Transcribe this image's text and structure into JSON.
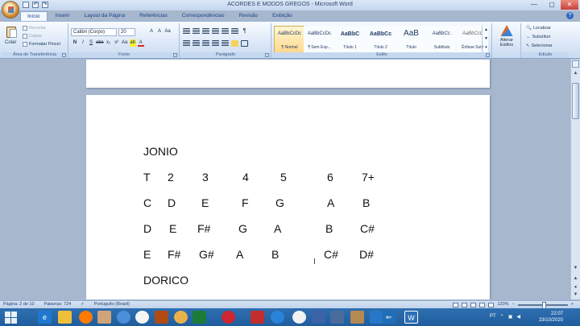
{
  "window": {
    "title": "ACORDES E MODOS GREGOS - Microsoft Word",
    "controls": [
      "—",
      "▢",
      "✕"
    ]
  },
  "ribbon": {
    "tabs": [
      "Início",
      "Inserir",
      "Layout da Página",
      "Referências",
      "Correspondências",
      "Revisão",
      "Exibição"
    ],
    "help": "?",
    "clipboard": {
      "paste": "Colar",
      "cut": "Recortar",
      "copy": "Copiar",
      "format_painter": "Formatar Pincel",
      "label": "Área de Transferência"
    },
    "font": {
      "name": "Calibri (Corpo)",
      "size": "20",
      "grow": "A",
      "shrink": "A",
      "clear": "Aa",
      "bold": "N",
      "italic": "I",
      "underline": "S",
      "strike": "abc",
      "subscript": "x₂",
      "superscript": "x²",
      "change_case": "Aa",
      "highlight": "ab",
      "font_color": "A",
      "label": "Fonte"
    },
    "paragraph": {
      "label": "Parágrafo",
      "pilcrow": "¶"
    },
    "styles": {
      "items": [
        {
          "sample": "AaBbCcDc",
          "name": "¶ Normal"
        },
        {
          "sample": "AaBbCcDc",
          "name": "¶ Sem Esp..."
        },
        {
          "sample": "AaBbC",
          "name": "Título 1"
        },
        {
          "sample": "AaBbCc",
          "name": "Título 2"
        },
        {
          "sample": "AaB",
          "name": "Título"
        },
        {
          "sample": "AaBbCc.",
          "name": "Subtítulo"
        },
        {
          "sample": "AaBbCcL",
          "name": "Ênfase Sutil"
        }
      ],
      "label": "Estilo"
    },
    "change_styles": "Alterar Estilos",
    "editing": {
      "find": "Localizar",
      "replace": "Substituir",
      "select": "Selecionar",
      "label": "Edição"
    }
  },
  "document": {
    "mode_title_1": "JONIO",
    "row_t": [
      "T",
      "2",
      "3",
      "4",
      "5",
      "6",
      "7+"
    ],
    "row_c": [
      "C",
      "D",
      "E",
      "F",
      "G",
      "A",
      "B"
    ],
    "row_d": [
      "D",
      "E",
      "F#",
      "G",
      "A",
      "B",
      "C#"
    ],
    "row_e": [
      "E",
      "F#",
      "G#",
      "A",
      "B",
      "C#",
      "D#"
    ],
    "mode_title_2": "DORICO"
  },
  "status": {
    "page": "Página: 2 de 10",
    "words": "Palavras: 724",
    "language": "Português (Brasil)",
    "zoom": "120%"
  },
  "taskbar": {
    "language": "PT",
    "time": "22:07",
    "date": "23/10/2020"
  },
  "colors": {
    "ribbon": "#dce8f7",
    "document_background": "#a7b7cd",
    "taskbar": "#2466a5"
  }
}
